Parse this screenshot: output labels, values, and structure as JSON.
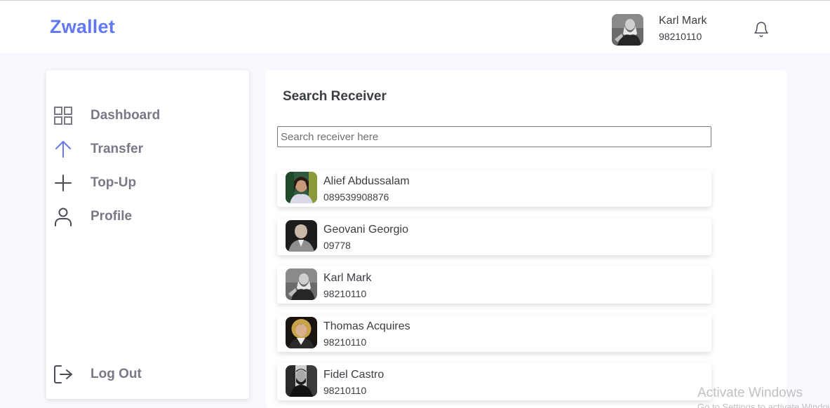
{
  "app": {
    "brand": "Zwallet"
  },
  "header": {
    "user_name": "Karl Mark",
    "user_phone": "98210110",
    "avatar_icon": "portrait-photo",
    "notification_icon": "bell-icon"
  },
  "sidebar": {
    "items": [
      {
        "label": "Dashboard",
        "icon": "grid-icon",
        "active": false
      },
      {
        "label": "Transfer",
        "icon": "arrow-up-icon",
        "active": true
      },
      {
        "label": "Top-Up",
        "icon": "plus-icon",
        "active": false
      },
      {
        "label": "Profile",
        "icon": "user-icon",
        "active": false
      }
    ],
    "logout": {
      "label": "Log Out",
      "icon": "logout-icon"
    }
  },
  "main": {
    "title": "Search Receiver",
    "search": {
      "placeholder": "Search receiver here",
      "value": ""
    },
    "receivers": [
      {
        "name": "Alief Abdussalam",
        "phone": "089539908876"
      },
      {
        "name": "Geovani Georgio",
        "phone": "09778"
      },
      {
        "name": "Karl Mark",
        "phone": "98210110"
      },
      {
        "name": "Thomas Acquires",
        "phone": "98210110"
      },
      {
        "name": "Fidel Castro",
        "phone": "98210110"
      }
    ]
  },
  "watermark": {
    "line1": "Activate Windows",
    "line2": "Go to Settings to activate Windows."
  },
  "colors": {
    "accent": "#6379f4",
    "background": "#f8f9fe",
    "nav_text": "#7a7886",
    "text": "#3a3d42"
  }
}
